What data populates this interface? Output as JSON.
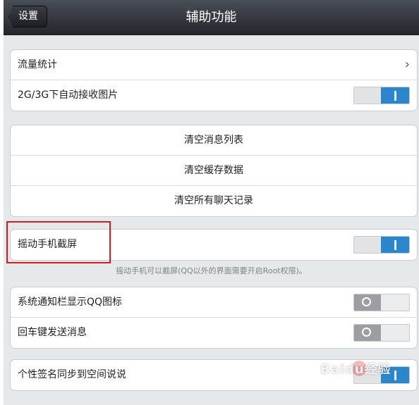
{
  "header": {
    "back_label": "设置",
    "title": "辅助功能"
  },
  "group1": {
    "traffic_stats": "流量统计",
    "auto_receive_images": "2G/3G下自动接收图片",
    "auto_receive_images_on": true
  },
  "group2": {
    "clear_message_list": "清空消息列表",
    "clear_cache": "清空缓存数据",
    "clear_chat_history": "清空所有聊天记录"
  },
  "group3": {
    "shake_screenshot": "摇动手机截屏",
    "shake_screenshot_on": true,
    "hint": "摇动手机可以截屏(QQ以外的界面需要开启Root权限)。"
  },
  "group4": {
    "show_qq_icon": "系统通知栏显示QQ图标",
    "show_qq_icon_on": false,
    "enter_to_send": "回车键发送消息",
    "enter_to_send_on": false
  },
  "group5": {
    "sync_signature": "个性签名同步到空间说说",
    "sync_signature_on": true
  },
  "watermark": "Baidu经验",
  "colors": {
    "accent_blue": "#2b86cc",
    "highlight_red": "#d21b1b",
    "navbar_dark": "#23262b"
  },
  "icons": [
    "chevron-right-icon"
  ]
}
